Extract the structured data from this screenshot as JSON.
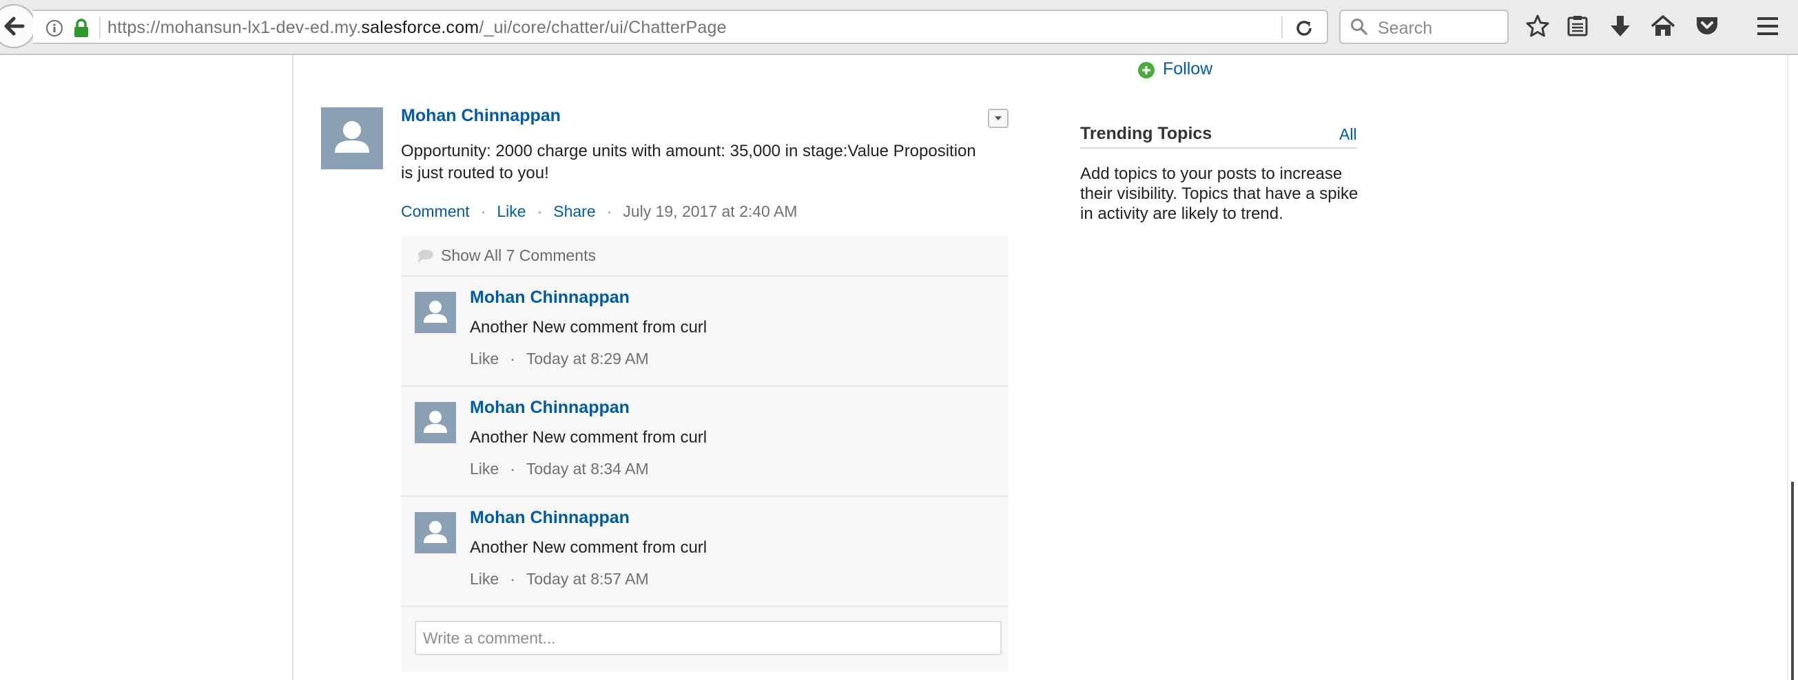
{
  "browser": {
    "url_prefix": "https://mohansun-lx1-dev-ed.my.",
    "url_domain": "salesforce.com",
    "url_path": "/_ui/core/chatter/ui/ChatterPage",
    "search_placeholder": "Search"
  },
  "profile": {
    "follow_label": "Follow"
  },
  "post": {
    "author": "Mohan Chinnappan",
    "body": "Opportunity: 2000 charge units with amount: 35,000 in stage:Value Proposition is just routed to you!",
    "actions": {
      "comment": "Comment",
      "like": "Like",
      "share": "Share",
      "separator": "·"
    },
    "timestamp": "July 19, 2017 at 2:40 AM"
  },
  "comments": {
    "show_all_label": "Show All 7 Comments",
    "items": [
      {
        "author": "Mohan Chinnappan",
        "text": "Another New comment from curl",
        "like": "Like",
        "time": "Today at 8:29 AM"
      },
      {
        "author": "Mohan Chinnappan",
        "text": "Another New comment from curl",
        "like": "Like",
        "time": "Today at 8:34 AM"
      },
      {
        "author": "Mohan Chinnappan",
        "text": "Another New comment from curl",
        "like": "Like",
        "time": "Today at 8:57 AM"
      }
    ],
    "write_placeholder": "Write a comment..."
  },
  "trending": {
    "title": "Trending Topics",
    "all_link": "All",
    "body": "Add topics to your posts to increase their visibility. Topics that have a spike in activity are likely to trend."
  },
  "colors": {
    "link": "#015ba7",
    "avatar": "#8ba0b5",
    "follow_green": "#4bab3e"
  }
}
